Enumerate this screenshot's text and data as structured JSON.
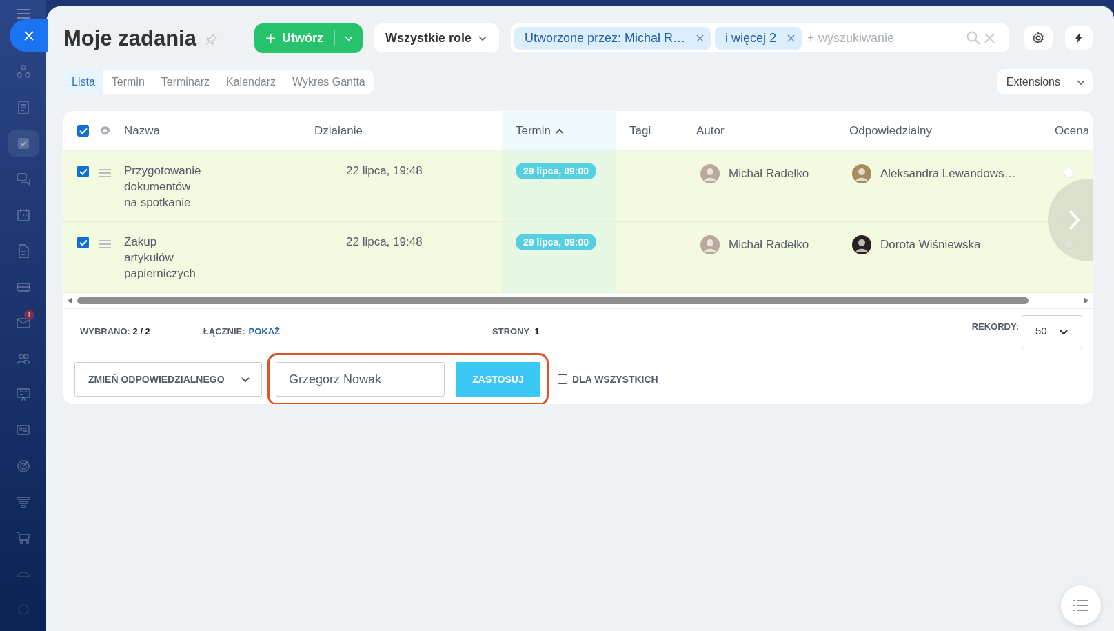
{
  "sidebar": {
    "mail_badge": "1"
  },
  "title": "Moje zadania",
  "create_button": "Utwórz",
  "role_filter": "Wszystkie role",
  "filter_tags": [
    "Utworzone przez: Michał R…",
    "i więcej 2"
  ],
  "search": {
    "prefix": "+",
    "placeholder": "wyszukiwanie"
  },
  "view_tabs": [
    {
      "label": "Lista",
      "selected": true
    },
    {
      "label": "Termin",
      "selected": false
    },
    {
      "label": "Terminarz",
      "selected": false
    },
    {
      "label": "Kalendarz",
      "selected": false
    },
    {
      "label": "Wykres Gantta",
      "selected": false
    }
  ],
  "extensions_button": "Extensions",
  "table": {
    "select_all_checked": true,
    "columns": [
      {
        "label": "Nazwa",
        "sorted": false
      },
      {
        "label": "Działanie",
        "sorted": false
      },
      {
        "label": "Termin",
        "sorted": true
      },
      {
        "label": "Tagi",
        "sorted": false
      },
      {
        "label": "Autor",
        "sorted": false
      },
      {
        "label": "Odpowiedzialny",
        "sorted": false
      },
      {
        "label": "Ocena",
        "sorted": false
      }
    ],
    "rows": [
      {
        "checked": true,
        "name": "Przygotowanie\ndokumentów\nna spotkanie",
        "activity": "22 lipca, 19:48",
        "deadline": "29 lipca, 09:00",
        "author": "Michał Radełko",
        "responsible": "Aleksandra Lewandows…",
        "rated": false
      },
      {
        "checked": true,
        "name": "Zakup\nartykułów\npapierniczych",
        "activity": "22 lipca, 19:48",
        "deadline": "29 lipca, 09:00",
        "author": "Michał Radełko",
        "responsible": "Dorota Wiśniewska",
        "rated": false
      }
    ]
  },
  "footer": {
    "selected_label": "WYBRANO:",
    "selected_value": "2 / 2",
    "total_label": "ŁĄCZNIE:",
    "total_link": "POKAŻ",
    "pages_label": "STRONY",
    "pages_value": "1",
    "records_label": "REKORDY:",
    "records_value": "50"
  },
  "group_action": {
    "action": "ZMIEŃ ODPOWIEDZIALNEGO",
    "user_value": "Grzegorz Nowak",
    "apply_button": "ZASTOSUJ",
    "for_all": {
      "label": "DLA WSZYSTKICH",
      "checked": false
    }
  }
}
